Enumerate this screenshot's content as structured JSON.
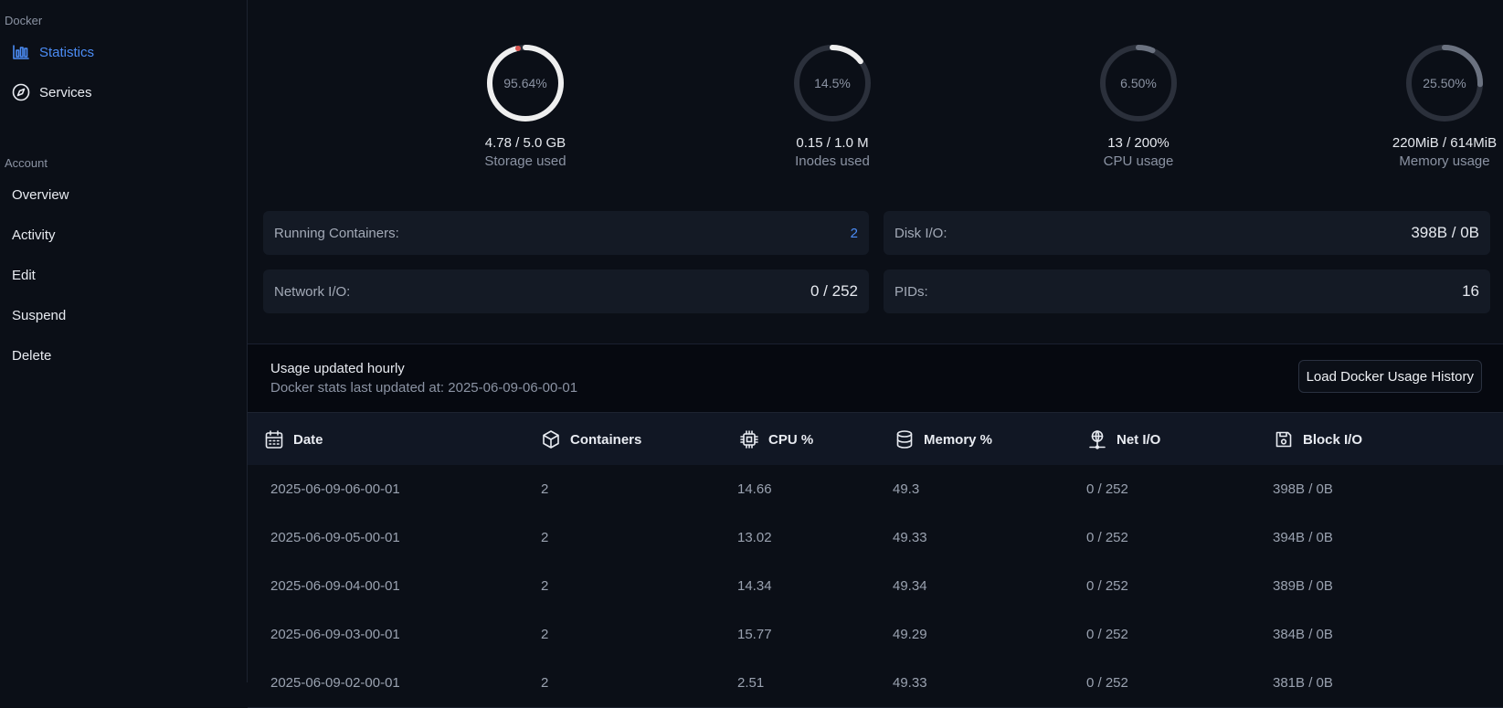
{
  "sidebar": {
    "docker_section": "Docker",
    "account_section": "Account",
    "items": [
      {
        "label": "Statistics"
      },
      {
        "label": "Services"
      },
      {
        "label": "Overview"
      },
      {
        "label": "Activity"
      },
      {
        "label": "Edit"
      },
      {
        "label": "Suspend"
      },
      {
        "label": "Delete"
      }
    ]
  },
  "gauges": [
    {
      "percent_text": "95.64%",
      "fraction": 0.9564,
      "value": "4.78 / 5.0 GB",
      "label": "Storage used",
      "color": "#efefef"
    },
    {
      "percent_text": "14.5%",
      "fraction": 0.145,
      "value": "0.15 / 1.0 M",
      "label": "Inodes used",
      "color": "#efefef"
    },
    {
      "percent_text": "6.50%",
      "fraction": 0.065,
      "value": "13 / 200%",
      "label": "CPU usage",
      "color": "#6b7280"
    },
    {
      "percent_text": "25.50%",
      "fraction": 0.255,
      "value": "220MiB / 614MiB",
      "label": "Memory usage",
      "color": "#6b7280"
    }
  ],
  "stats": {
    "running_containers": {
      "label": "Running Containers:",
      "value": "2"
    },
    "disk_io": {
      "label": "Disk I/O:",
      "value": "398B / 0B"
    },
    "network_io": {
      "label": "Network I/O:",
      "value": "0 / 252"
    },
    "pids": {
      "label": "PIDs:",
      "value": "16"
    }
  },
  "history": {
    "title": "Usage updated hourly",
    "subtitle": "Docker stats last updated at: 2025-06-09-06-00-01",
    "load_button": "Load Docker Usage History"
  },
  "table": {
    "columns": [
      "Date",
      "Containers",
      "CPU %",
      "Memory %",
      "Net I/O",
      "Block I/O"
    ],
    "rows": [
      [
        "2025-06-09-06-00-01",
        "2",
        "14.66",
        "49.3",
        "0 / 252",
        "398B / 0B"
      ],
      [
        "2025-06-09-05-00-01",
        "2",
        "13.02",
        "49.33",
        "0 / 252",
        "394B / 0B"
      ],
      [
        "2025-06-09-04-00-01",
        "2",
        "14.34",
        "49.34",
        "0 / 252",
        "389B / 0B"
      ],
      [
        "2025-06-09-03-00-01",
        "2",
        "15.77",
        "49.29",
        "0 / 252",
        "384B / 0B"
      ],
      [
        "2025-06-09-02-00-01",
        "2",
        "2.51",
        "49.33",
        "0 / 252",
        "381B / 0B"
      ]
    ]
  },
  "colors": {
    "accent": "#4c8df6",
    "track": "#2b303b",
    "storage_tip": "#d9534f"
  }
}
